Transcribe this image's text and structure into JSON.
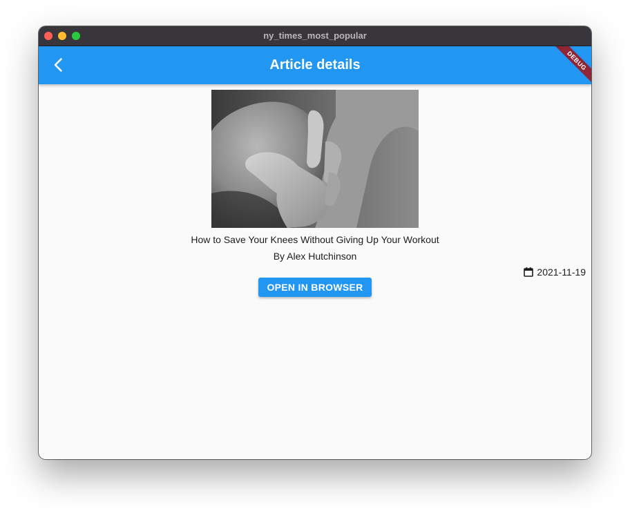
{
  "window": {
    "title": "ny_times_most_popular"
  },
  "appbar": {
    "title": "Article details",
    "back_icon": "chevron-left-icon",
    "color": "#2196f3",
    "debug_banner": "DEBUG"
  },
  "article": {
    "image_icon": "article-photo",
    "headline": "How to Save Your Knees Without Giving Up Your Workout",
    "byline": "By Alex Hutchinson",
    "date_icon": "calendar-icon",
    "date": "2021-11-19",
    "open_button_label": "OPEN IN BROWSER"
  }
}
